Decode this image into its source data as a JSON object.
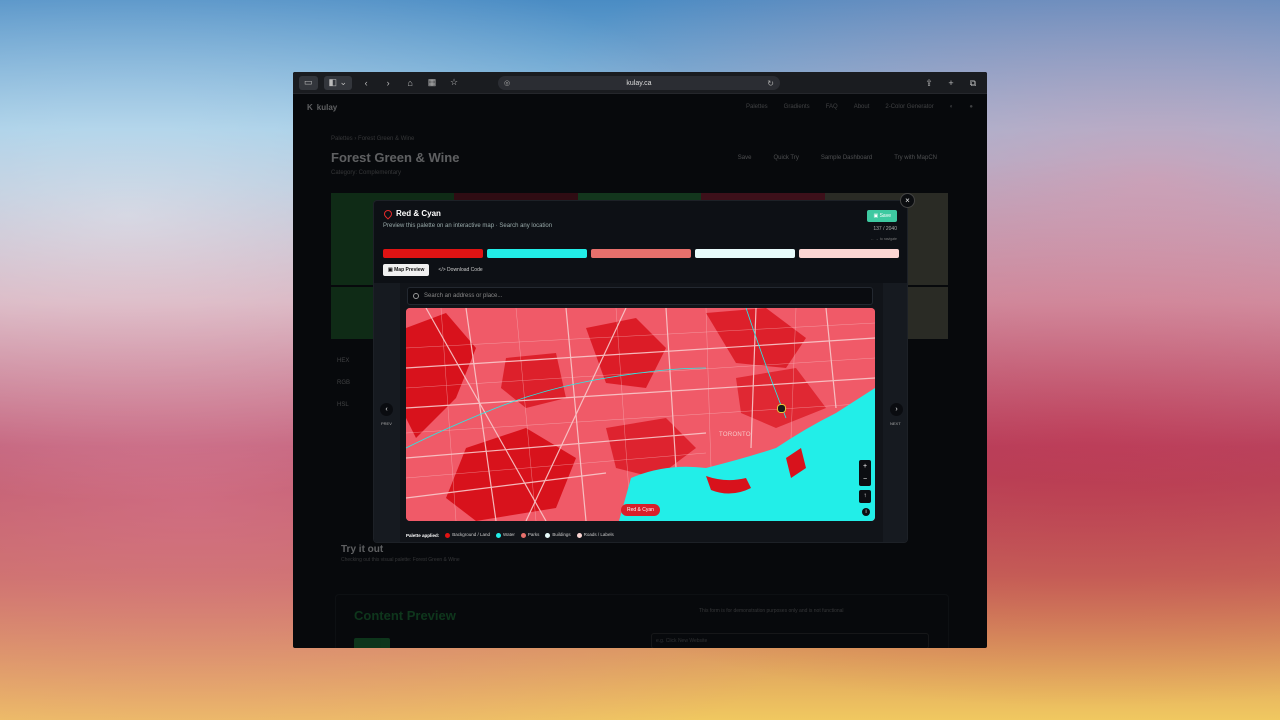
{
  "browser": {
    "url": "kulay.ca"
  },
  "site": {
    "brand": "kulay",
    "nav": [
      "Palettes",
      "Gradients",
      "FAQ",
      "About",
      "2-Color Generator"
    ],
    "breadcrumb_root": "Palettes",
    "breadcrumb_current": "Forest Green & Wine",
    "page_title": "Forest Green & Wine",
    "category": "Category: Complementary",
    "actions": [
      "Save",
      "Quick Try",
      "Sample Dashboard",
      "Try with MapCN"
    ],
    "rows": [
      "HEX",
      "RGB",
      "HSL"
    ],
    "try_title": "Try it out",
    "try_sub": "Checking out this visual palette: Forest Green & Wine",
    "preview_title": "Content Preview",
    "preview_note": "This form is for demonstration purposes only and is not functional",
    "preview_input": "e.g. Click New Website",
    "swatches": [
      "#1f6b2a",
      "#7a1420",
      "#2b8a3e",
      "#a11f34",
      "#6b6b55"
    ]
  },
  "modal": {
    "title": "Red & Cyan",
    "subtitle": "Preview this palette on an interactive map · Search any location",
    "save_label": "Save",
    "counter": "137 / 2040",
    "hint": "← → to navigate",
    "palette": [
      "#e01313",
      "#22eee8",
      "#e7706c",
      "#e8fbfb",
      "#fbd6d3"
    ],
    "tabs": [
      {
        "label": "Map Preview",
        "active": true
      },
      {
        "label": "Download Code",
        "active": false
      }
    ],
    "search_placeholder": "Search an address or place...",
    "prev_label": "PREV",
    "next_label": "NEXT",
    "city_label": "TORONTO",
    "badge": "Red & Cyan",
    "legend_title": "Palette applied:",
    "legend": [
      {
        "label": "Background / Land",
        "color": "#e01313"
      },
      {
        "label": "Water",
        "color": "#22eee8"
      },
      {
        "label": "Parks",
        "color": "#e7706c"
      },
      {
        "label": "Buildings",
        "color": "#e8fbfb"
      },
      {
        "label": "Roads / Labels",
        "color": "#fbd6d3"
      }
    ]
  },
  "colors": {
    "water": "#22eee8",
    "land": "#f05a68",
    "park": "#d8121c",
    "road": "#f8c9cb",
    "accent": "#3ec9a1"
  }
}
